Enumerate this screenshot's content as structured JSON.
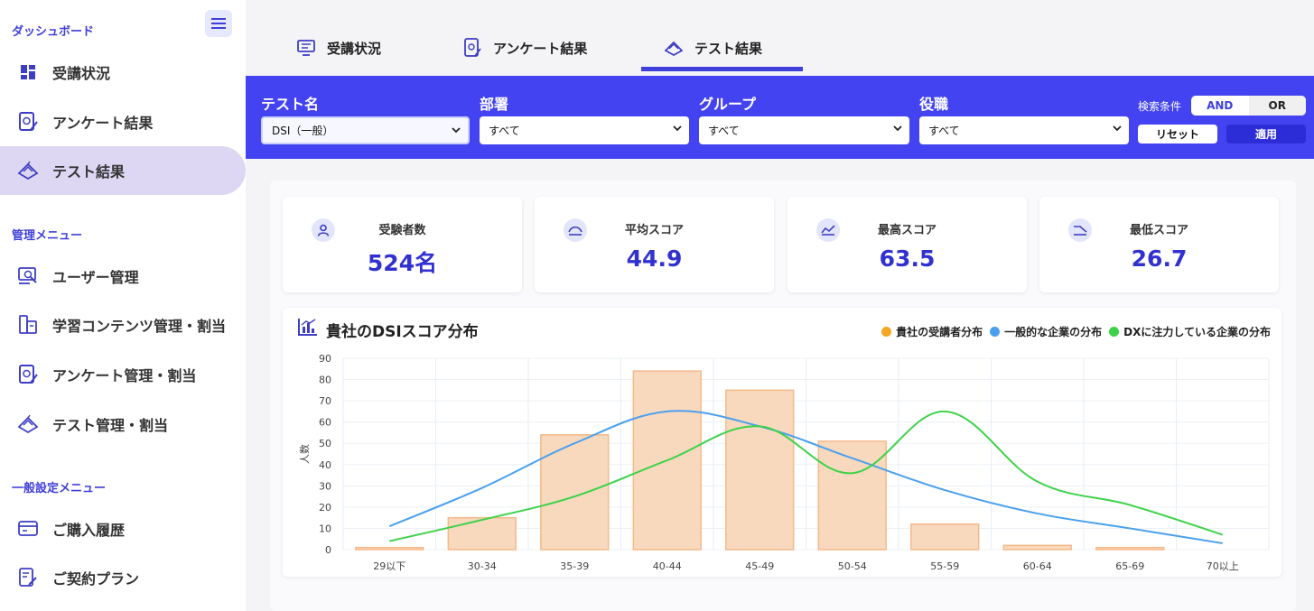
{
  "sidebar": {
    "dashboard_title": "ダッシュボード",
    "dashboard_items": [
      {
        "label": "受講状況"
      },
      {
        "label": "アンケート結果"
      },
      {
        "label": "テスト結果"
      }
    ],
    "admin_title": "管理メニュー",
    "admin_items": [
      {
        "label": "ユーザー管理"
      },
      {
        "label": "学習コンテンツ管理・割当"
      },
      {
        "label": "アンケート管理・割当"
      },
      {
        "label": "テスト管理・割当"
      }
    ],
    "settings_title": "一般設定メニュー",
    "settings_items": [
      {
        "label": "ご購入履歴"
      },
      {
        "label": "ご契約プラン"
      }
    ]
  },
  "tabs": [
    {
      "label": "受講状況"
    },
    {
      "label": "アンケート結果"
    },
    {
      "label": "テスト結果"
    }
  ],
  "filters": {
    "test_name": {
      "label": "テスト名",
      "value": "DSI（一般）"
    },
    "department": {
      "label": "部署",
      "value": "すべて"
    },
    "group": {
      "label": "グループ",
      "value": "すべて"
    },
    "position": {
      "label": "役職",
      "value": "すべて"
    },
    "condition_label": "検索条件",
    "and_label": "AND",
    "or_label": "OR",
    "reset_label": "リセット",
    "apply_label": "適用"
  },
  "stats": [
    {
      "label": "受験者数",
      "value": "524名"
    },
    {
      "label": "平均スコア",
      "value": "44.9"
    },
    {
      "label": "最高スコア",
      "value": "63.5"
    },
    {
      "label": "最低スコア",
      "value": "26.7"
    }
  ],
  "colors": {
    "accent": "#4343f1",
    "bar": "#f9d9bd",
    "bar_stroke": "#f3b98a",
    "blue": "#4aa0ee",
    "green": "#3ed24a",
    "orange": "#f5a623"
  },
  "chart_data": {
    "type": "bar",
    "title": "貴社のDSIスコア分布",
    "ylabel": "人数",
    "xlabel": "",
    "ylim": [
      0,
      90
    ],
    "yticks": [
      "0",
      "10",
      "20",
      "30",
      "40",
      "50",
      "60",
      "70",
      "80",
      "90"
    ],
    "categories": [
      "29以下",
      "30-34",
      "35-39",
      "40-44",
      "45-49",
      "50-54",
      "55-59",
      "60-64",
      "65-69",
      "70以上"
    ],
    "legend_position": "top-right",
    "grid": true,
    "series": [
      {
        "name": "貴社の受講者分布",
        "type": "bar",
        "values": [
          1,
          15,
          54,
          84,
          75,
          51,
          12,
          2,
          1,
          0
        ]
      },
      {
        "name": "一般的な企業の分布",
        "type": "line",
        "values": [
          11,
          29,
          50,
          65,
          58,
          43,
          28,
          17,
          10,
          3
        ]
      },
      {
        "name": "DXに注力している企業の分布",
        "type": "line",
        "values": [
          4,
          14,
          25,
          42,
          58,
          36,
          65,
          32,
          21,
          7
        ]
      }
    ]
  }
}
